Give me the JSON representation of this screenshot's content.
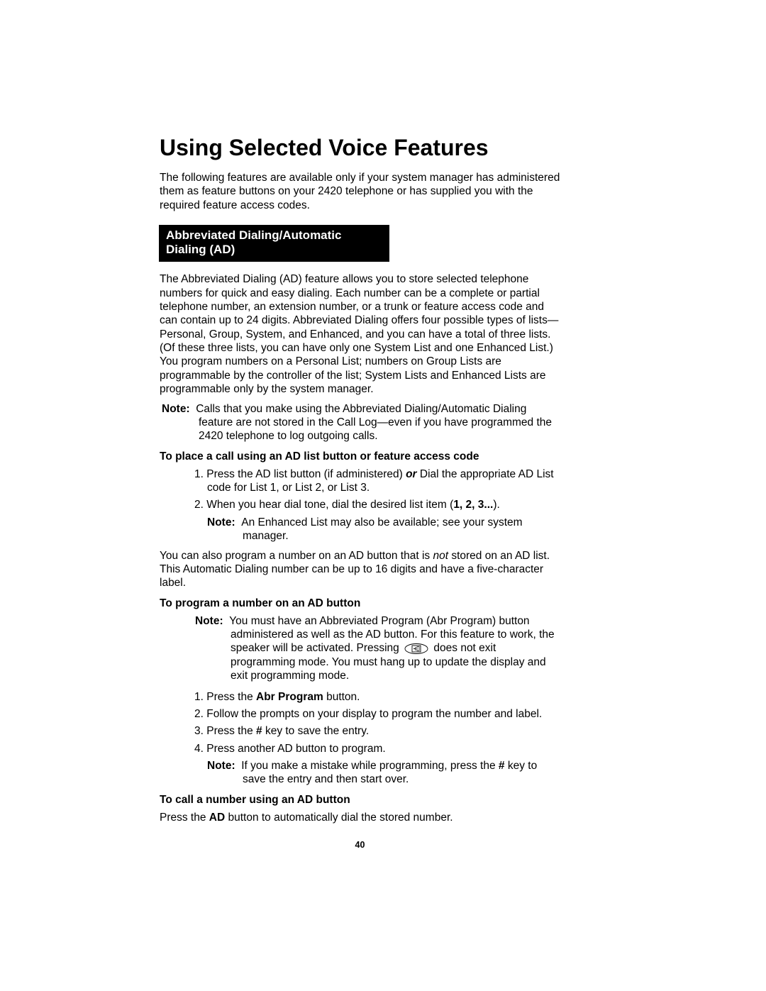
{
  "title": "Using Selected Voice Features",
  "intro": "The following features are available only if your system manager has administered them as feature buttons on your 2420 telephone or has supplied you with the required feature access codes.",
  "section_header": "Abbreviated Dialing/Automatic Dialing (AD)",
  "ad_para": "The Abbreviated Dialing (AD) feature allows you to store selected telephone numbers for quick and easy dialing. Each number can be a complete or partial telephone number, an extension number, or a trunk or feature access code and can contain up to 24 digits. Abbreviated Dialing offers four possible types of lists—Personal, Group, System, and Enhanced, and you can have a total of three lists. (Of these three lists, you can have only one System List and one Enhanced List.) You program numbers on a Personal List; numbers on Group Lists are programmable by the controller of the list; System Lists and Enhanced Lists are programmable only by the system manager.",
  "note1_label": "Note:",
  "note1_text": "Calls that you make using the Abbreviated Dialing/Automatic Dialing feature are not stored in the Call Log—even if you have programmed the 2420 telephone to log outgoing calls.",
  "sub1": "To place a call using an AD list button or feature access code",
  "step1_1a": "1. Press the AD list button (if administered) ",
  "step1_1b": "or",
  "step1_1c": " Dial the appropriate AD List code for List 1, or List 2, or List 3.",
  "step1_2a": "2. When you hear dial tone, dial the desired list item (",
  "step1_2b": "1, 2, 3...",
  "step1_2c": ").",
  "note2_label": "Note:",
  "note2_text": "An Enhanced List may also be available; see your system manager.",
  "para2a": "You can also program a number on an AD button that is ",
  "para2b": "not",
  "para2c": " stored on an AD list. This Automatic Dialing number can be up to 16 digits and have a five-character label.",
  "sub2": "To program a number on an AD button",
  "note3_label": "Note:",
  "note3_text_a": "You must have an Abbreviated Program (Abr Program) button administered as well as the AD button. For this feature to work, the speaker will be activated. Pressing ",
  "note3_text_b": " does not exit programming mode. You must hang up to update the display and exit programming mode.",
  "step2_1a": "1. Press the ",
  "step2_1b": "Abr Program",
  "step2_1c": " button.",
  "step2_2": "2. Follow the prompts on your display to program the number and label.",
  "step2_3a": "3. Press the ",
  "step2_3b": "#",
  "step2_3c": " key to save the entry.",
  "step2_4": "4. Press another AD button to program.",
  "note4_label": "Note:",
  "note4_text_a": "If you make a mistake while programming, press the ",
  "note4_text_b": "#",
  "note4_text_c": " key to save the entry and then start over.",
  "sub3": "To call a number using an AD button",
  "final_a": "Press the ",
  "final_b": "AD",
  "final_c": " button to automatically dial the stored number.",
  "page_number": "40"
}
